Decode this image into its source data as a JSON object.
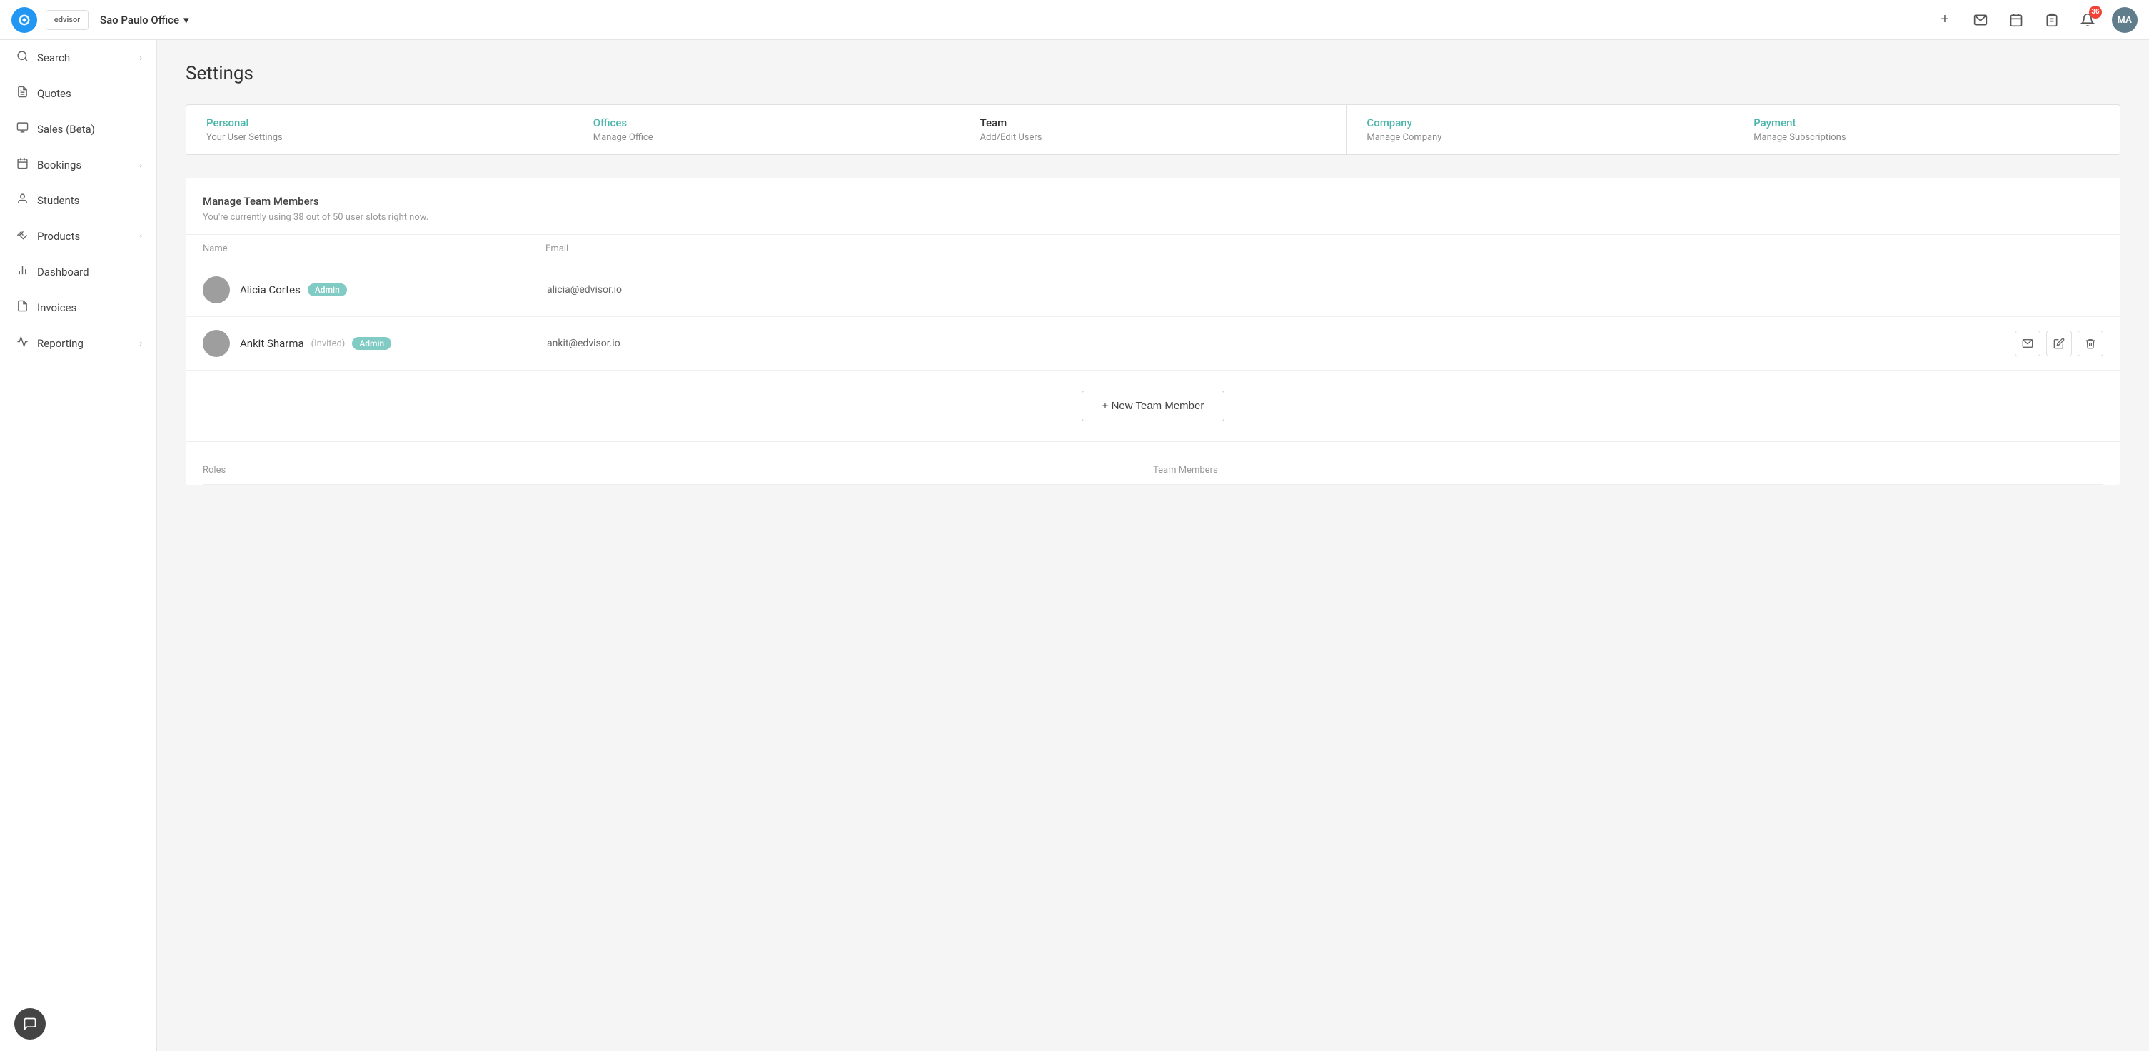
{
  "header": {
    "app_logo_initials": "edvisor",
    "office_name": "Sao Paulo Office",
    "chevron": "▾",
    "notification_count": "36",
    "avatar_initials": "MA",
    "plus_label": "+",
    "icons": {
      "messages": "✉",
      "calendar": "📅",
      "clipboard": "📋",
      "bell": "🔔"
    }
  },
  "sidebar": {
    "items": [
      {
        "id": "search",
        "label": "Search",
        "icon": "🔍",
        "has_chevron": true
      },
      {
        "id": "quotes",
        "label": "Quotes",
        "icon": "📄",
        "has_chevron": false
      },
      {
        "id": "sales",
        "label": "Sales (Beta)",
        "icon": "🖥",
        "has_chevron": false
      },
      {
        "id": "bookings",
        "label": "Bookings",
        "icon": "📅",
        "has_chevron": true
      },
      {
        "id": "students",
        "label": "Students",
        "icon": "👤",
        "has_chevron": false
      },
      {
        "id": "products",
        "label": "Products",
        "icon": "🏷",
        "has_chevron": true
      },
      {
        "id": "dashboard",
        "label": "Dashboard",
        "icon": "📊",
        "has_chevron": false
      },
      {
        "id": "invoices",
        "label": "Invoices",
        "icon": "🧾",
        "has_chevron": false
      },
      {
        "id": "reporting",
        "label": "Reporting",
        "icon": "📈",
        "has_chevron": true
      }
    ],
    "chat_button_icon": "💬"
  },
  "page": {
    "title": "Settings"
  },
  "tabs": [
    {
      "id": "personal",
      "name": "Personal",
      "sub": "Your User Settings",
      "color": "teal",
      "active": false
    },
    {
      "id": "offices",
      "name": "Offices",
      "sub": "Manage Office",
      "color": "teal",
      "active": false
    },
    {
      "id": "team",
      "name": "Team",
      "sub": "Add/Edit Users",
      "color": "dark",
      "active": true
    },
    {
      "id": "company",
      "name": "Company",
      "sub": "Manage Company",
      "color": "teal",
      "active": false
    },
    {
      "id": "payment",
      "name": "Payment",
      "sub": "Manage Subscriptions",
      "color": "teal",
      "active": false
    }
  ],
  "team": {
    "section_title": "Manage Team Members",
    "slots_info": "You're currently using 38 out of 50 user slots right now.",
    "col_name": "Name",
    "col_email": "Email",
    "members": [
      {
        "id": "alicia",
        "name": "Alicia Cortes",
        "invited": "",
        "role": "Admin",
        "email": "alicia@edvisor.io",
        "show_actions": false
      },
      {
        "id": "ankit",
        "name": "Ankit Sharma",
        "invited": "(Invited)",
        "role": "Admin",
        "email": "ankit@edvisor.io",
        "show_actions": true
      }
    ],
    "new_member_btn": "+ New Team Member",
    "roles_col": "Roles",
    "team_members_col": "Team Members"
  }
}
